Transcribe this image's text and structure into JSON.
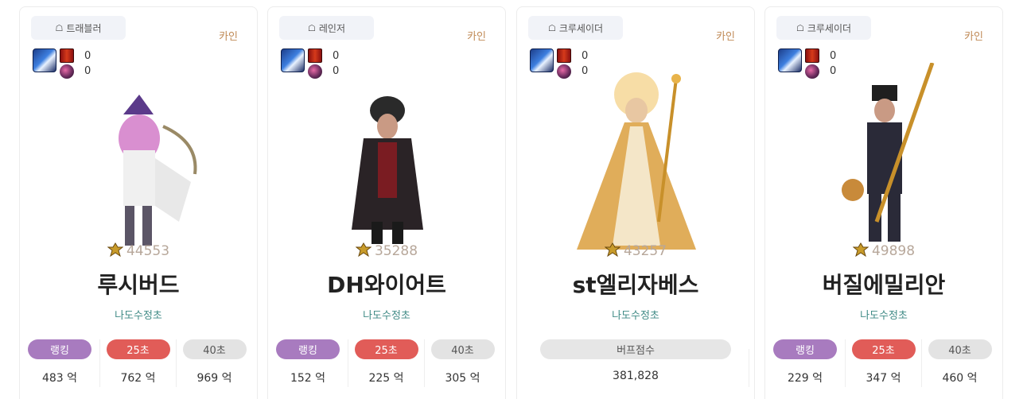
{
  "fame_icon": "fame-crest-icon",
  "awaken_icon": "awakening-badge-icon",
  "colors": {
    "ranking": "#a87bbf",
    "t25": "#e15c58",
    "t40": "#e3e3e3",
    "guild": "#3f8a85",
    "server": "#c08a56"
  },
  "cards": [
    {
      "job": "트래블러",
      "server": "카인",
      "counts": [
        "0",
        "0"
      ],
      "fame": "44553",
      "name": "루시버드",
      "guild": "나도수정초",
      "stats": [
        {
          "label": "랭킹",
          "value": "483 억"
        },
        {
          "label": "25초",
          "value": "762 억"
        },
        {
          "label": "40초",
          "value": "969 억"
        }
      ]
    },
    {
      "job": "레인저",
      "server": "카인",
      "counts": [
        "0",
        "0"
      ],
      "fame": "35288",
      "name": "DH와이어트",
      "guild": "나도수정초",
      "stats": [
        {
          "label": "랭킹",
          "value": "152 억"
        },
        {
          "label": "25초",
          "value": "225 억"
        },
        {
          "label": "40초",
          "value": "305 억"
        }
      ]
    },
    {
      "job": "크루세이더",
      "server": "카인",
      "counts": [
        "0",
        "0"
      ],
      "fame": "43257",
      "name": "st엘리자베스",
      "guild": "나도수정초",
      "buff": {
        "label": "버프점수",
        "value": "381,828"
      }
    },
    {
      "job": "크루세이더",
      "server": "카인",
      "counts": [
        "0",
        "0"
      ],
      "fame": "49898",
      "name": "버질에밀리안",
      "guild": "나도수정초",
      "stats": [
        {
          "label": "랭킹",
          "value": "229 억"
        },
        {
          "label": "25초",
          "value": "347 억"
        },
        {
          "label": "40초",
          "value": "460 억"
        }
      ]
    }
  ]
}
